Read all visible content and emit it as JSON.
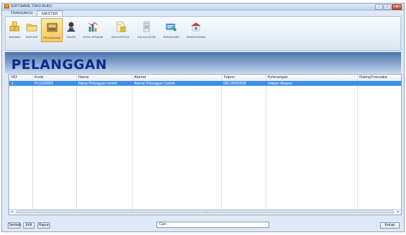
{
  "window": {
    "title": "SOFTWARE TOKO BUKU"
  },
  "tabs": [
    {
      "label": "TRANSAKSI"
    },
    {
      "label": "MASTER"
    }
  ],
  "ribbon": [
    {
      "label": "BARANG",
      "icon": "box-stack-icon"
    },
    {
      "label": "SUPLIER",
      "icon": "folder-icon"
    },
    {
      "label": "PELANGGAN",
      "icon": "customer-card-icon"
    },
    {
      "label": "SALES",
      "icon": "person-icon"
    },
    {
      "label": "STOK OPNAME",
      "icon": "stock-chart-icon"
    },
    {
      "label": "BACKOFFICE",
      "icon": "office-document-icon"
    },
    {
      "label": "KALKULATOR",
      "icon": "calculator-icon"
    },
    {
      "label": "PASSWORD",
      "icon": "password-icon"
    },
    {
      "label": "PENGATURAN",
      "icon": "settings-icon"
    }
  ],
  "page": {
    "title": "PELANGGAN"
  },
  "table": {
    "columns": [
      "NO",
      "Kode",
      "Nama",
      "Alamat",
      "Telpon",
      "Keterangan",
      "RatingTransaksi"
    ],
    "rows": [
      [
        "1",
        "PLG000001",
        "Nama Pelanggan contoh",
        "Alamat Pelanggan Contoh",
        "031-00000000",
        "silakan dihapus",
        ""
      ]
    ]
  },
  "buttons": {
    "tambah": "Tambah",
    "edit": "Edit",
    "hapus": "Hapus",
    "keluar": "Keluar"
  },
  "search": {
    "value": "Cari..."
  },
  "colors": {
    "accent": "#3f8fe8",
    "title": "#0f2a8c",
    "band": "#4e74ae"
  }
}
